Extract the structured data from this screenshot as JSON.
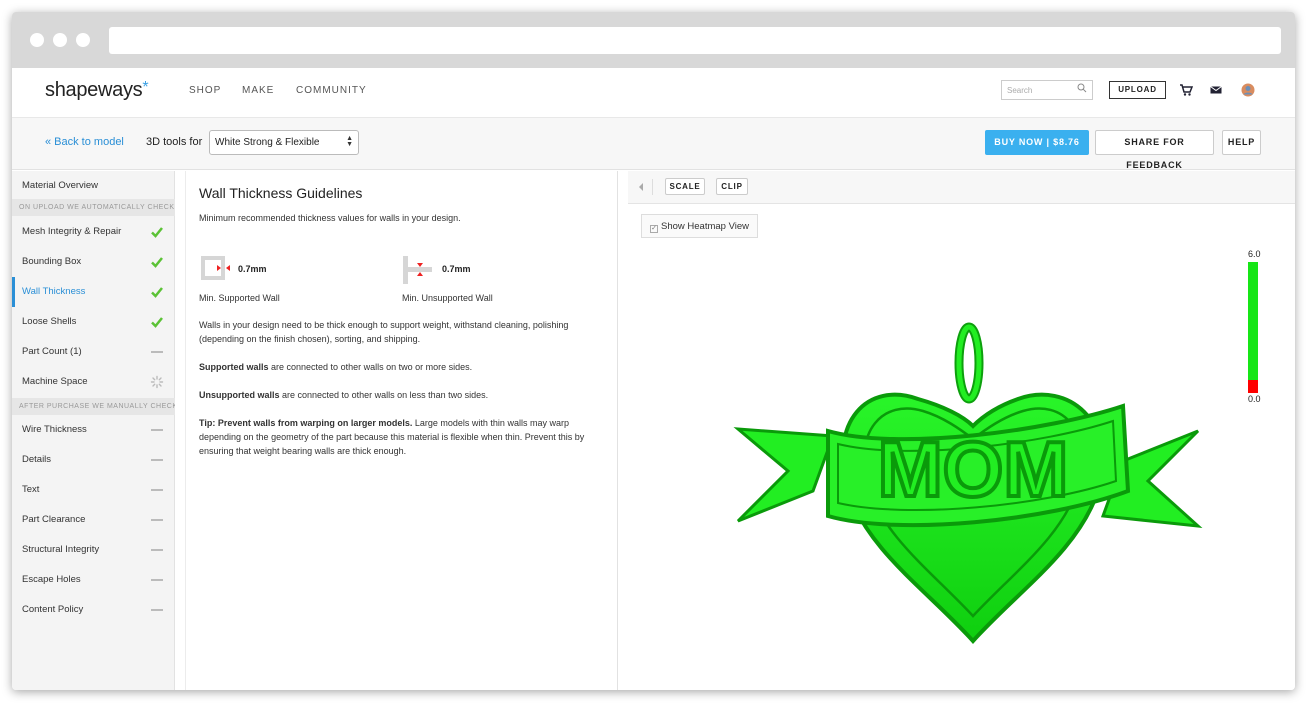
{
  "brand": {
    "name": "shapeways",
    "mark": "*"
  },
  "nav": {
    "links": [
      "SHOP",
      "MAKE",
      "COMMUNITY"
    ],
    "search_placeholder": "Search",
    "upload_label": "UPLOAD"
  },
  "toolbar": {
    "back_label": "« Back to model",
    "tools_for_label": "3D tools for",
    "material_selected": "White Strong & Flexible",
    "buy_now_label": "BUY NOW  |  $8.76",
    "share_label": "SHARE FOR FEEDBACK",
    "help_label": "HELP"
  },
  "sidebar": {
    "overview": "Material Overview",
    "auto_header": "ON UPLOAD WE AUTOMATICALLY CHECK...",
    "auto_items": [
      {
        "label": "Mesh Integrity & Repair",
        "status": "pass"
      },
      {
        "label": "Bounding Box",
        "status": "pass"
      },
      {
        "label": "Wall Thickness",
        "status": "pass"
      },
      {
        "label": "Loose Shells",
        "status": "pass"
      },
      {
        "label": "Part Count (1)",
        "status": "none"
      },
      {
        "label": "Machine Space",
        "status": "loading"
      }
    ],
    "manual_header": "AFTER PURCHASE WE MANUALLY CHECK...",
    "manual_items": [
      {
        "label": "Wire Thickness",
        "status": "none"
      },
      {
        "label": "Details",
        "status": "none"
      },
      {
        "label": "Text",
        "status": "none"
      },
      {
        "label": "Part Clearance",
        "status": "none"
      },
      {
        "label": "Structural Integrity",
        "status": "none"
      },
      {
        "label": "Escape Holes",
        "status": "none"
      },
      {
        "label": "Content Policy",
        "status": "none"
      }
    ],
    "active": "Wall Thickness"
  },
  "content": {
    "title": "Wall Thickness Guidelines",
    "intro": "Minimum recommended thickness values for walls in your design.",
    "supported_value": "0.7mm",
    "supported_label": "Min. Supported Wall",
    "unsupported_value": "0.7mm",
    "unsupported_label": "Min. Unsupported Wall",
    "para1": "Walls in your design need to be thick enough to support weight, withstand cleaning, polishing (depending on the finish chosen), sorting, and shipping.",
    "para2_bold": "Supported walls",
    "para2_rest": " are connected to other walls on two or more sides.",
    "para3_bold": "Unsupported walls",
    "para3_rest": " are connected to other walls on less than two sides.",
    "para4_bold": "Tip: Prevent walls from warping on larger models.",
    "para4_rest": " Large models with thin walls may warp depending on the geometry of the part because this material is flexible when thin. Prevent this by ensuring that weight bearing walls are thick enough."
  },
  "viewer": {
    "scale_label": "SCALE",
    "clip_label": "CLIP",
    "heatmap_label": "Show Heatmap View",
    "heatmap_checked": true,
    "scale_max": "6.0",
    "scale_min": "0.0",
    "model_text": "MOM",
    "colors": {
      "ok": "#1de41d",
      "thin": "#ff0000"
    }
  }
}
